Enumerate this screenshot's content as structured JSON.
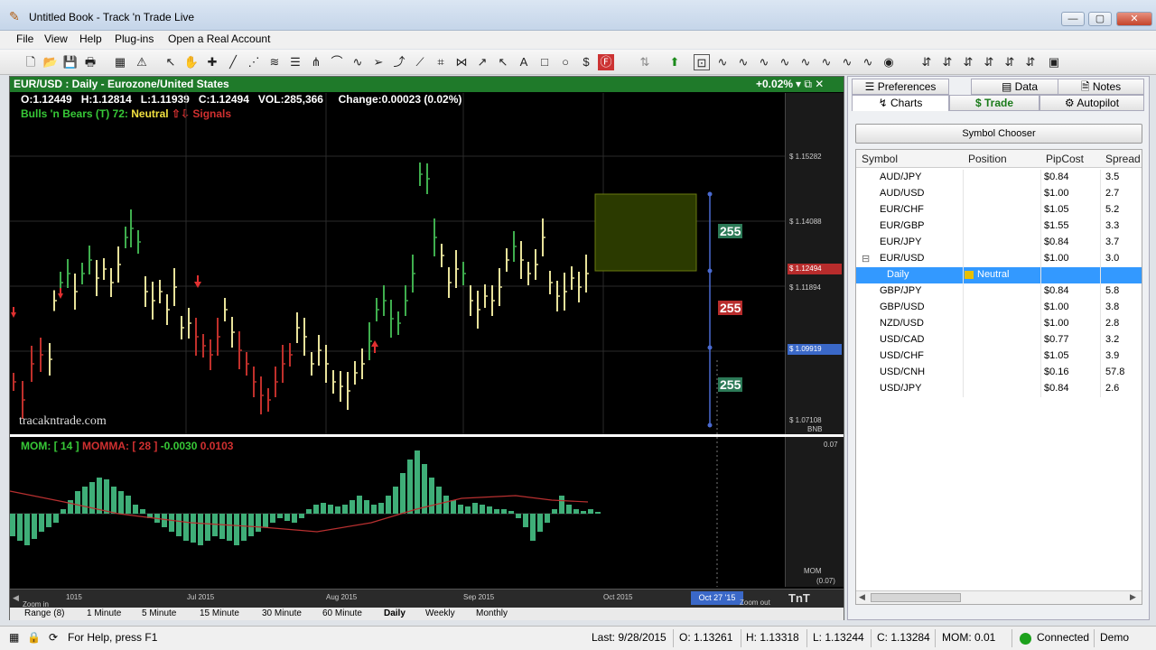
{
  "window": {
    "title": "Untitled Book - Track 'n Trade Live",
    "minimize": "—",
    "maximize": "▢",
    "close": "✕"
  },
  "menu": [
    "File",
    "View",
    "Help",
    "Plug-ins",
    "Open a Real Account"
  ],
  "chart": {
    "header_title": "EUR/USD : Daily  -  Eurozone/United States",
    "header_change": "+0.02%",
    "header_icons": "▾  ⧉  ✕",
    "ohlc": {
      "open": "O:1.12449",
      "high": "H:1.12814",
      "low": "L:1.11939",
      "close": "C:1.12494",
      "volume": "VOL:285,366",
      "change": "Change:0.00023 (0.02%)"
    },
    "indicator": {
      "name": "Bulls 'n Bears (T) 72:",
      "state": "Neutral",
      "signals": "⇧⇩ Signals",
      "name_color": "#37c837",
      "state_color": "#f0e040",
      "signals_color": "#d03030"
    },
    "price_labels": [
      "$ 1.15282",
      "$ 1.14088",
      "$ 1.12494",
      "$ 1.11894",
      "$ 1.09919",
      "$ 1.07108"
    ],
    "bnb": "BNB",
    "box_value_top": "255",
    "box_value_mid": "255",
    "box_value_bottom": "255",
    "watermark": "tracakntrade.com",
    "mom_header": {
      "mom": "MOM: [ 14 ]",
      "momma": "MOMMA: [ 28 ]",
      "v1": "-0.0030",
      "v2": "0.0103"
    },
    "mom_axis_top": "0.07",
    "mom_axis_label": "MOM",
    "mom_axis_bottom": "(0.07)",
    "time_labels": [
      "1015",
      "Jul 2015",
      "Aug 2015",
      "Sep 2015",
      "Oct 2015"
    ],
    "zoom_in": "Zoom in",
    "zoom_out": "Zoom out",
    "date_box": "Oct 27 '15",
    "tabs": [
      "Range (8)",
      "1 Minute",
      "5 Minute",
      "15 Minute",
      "30 Minute",
      "60 Minute",
      "Daily",
      "Weekly",
      "Monthly"
    ],
    "active_tab": "Daily"
  },
  "right_panel": {
    "tabs_row1": [
      "Preferences",
      "Data",
      "Notes"
    ],
    "tabs_row2": [
      "Charts",
      "$  Trade",
      "Autopilot"
    ],
    "symbol_chooser": "Symbol Chooser",
    "columns": [
      "Symbol",
      "Position",
      "PipCost",
      "Spread I"
    ],
    "rows": [
      {
        "symbol": "AUD/JPY",
        "position": "",
        "pipcost": "$0.84",
        "spread": "3.5"
      },
      {
        "symbol": "AUD/USD",
        "position": "",
        "pipcost": "$1.00",
        "spread": "2.7"
      },
      {
        "symbol": "EUR/CHF",
        "position": "",
        "pipcost": "$1.05",
        "spread": "5.2"
      },
      {
        "symbol": "EUR/GBP",
        "position": "",
        "pipcost": "$1.55",
        "spread": "3.3"
      },
      {
        "symbol": "EUR/JPY",
        "position": "",
        "pipcost": "$0.84",
        "spread": "3.7"
      },
      {
        "symbol": "EUR/USD",
        "position": "",
        "pipcost": "$1.00",
        "spread": "3.0"
      },
      {
        "symbol": "Daily",
        "position": "Neutral",
        "pipcost": "",
        "spread": ""
      },
      {
        "symbol": "GBP/JPY",
        "position": "",
        "pipcost": "$0.84",
        "spread": "5.8"
      },
      {
        "symbol": "GBP/USD",
        "position": "",
        "pipcost": "$1.00",
        "spread": "3.8"
      },
      {
        "symbol": "NZD/USD",
        "position": "",
        "pipcost": "$1.00",
        "spread": "2.8"
      },
      {
        "symbol": "USD/CAD",
        "position": "",
        "pipcost": "$0.77",
        "spread": "3.2"
      },
      {
        "symbol": "USD/CHF",
        "position": "",
        "pipcost": "$1.05",
        "spread": "3.9"
      },
      {
        "symbol": "USD/CNH",
        "position": "",
        "pipcost": "$0.16",
        "spread": "57.8"
      },
      {
        "symbol": "USD/JPY",
        "position": "",
        "pipcost": "$0.84",
        "spread": "2.6"
      }
    ]
  },
  "status": {
    "help": "For Help, press F1",
    "last": "Last:  9/28/2015",
    "open": "O: 1.13261",
    "high": "H: 1.13318",
    "low": "L: 1.13244",
    "close": "C: 1.13284",
    "mom": "MOM: 0.01",
    "connection": "Connected",
    "mode": "Demo"
  },
  "colors": {
    "bull": "#3fae4e",
    "bear": "#c0302b",
    "neutral": "#e8e29a",
    "header_green": "#1f7a2a",
    "select_blue": "#3399ff"
  }
}
